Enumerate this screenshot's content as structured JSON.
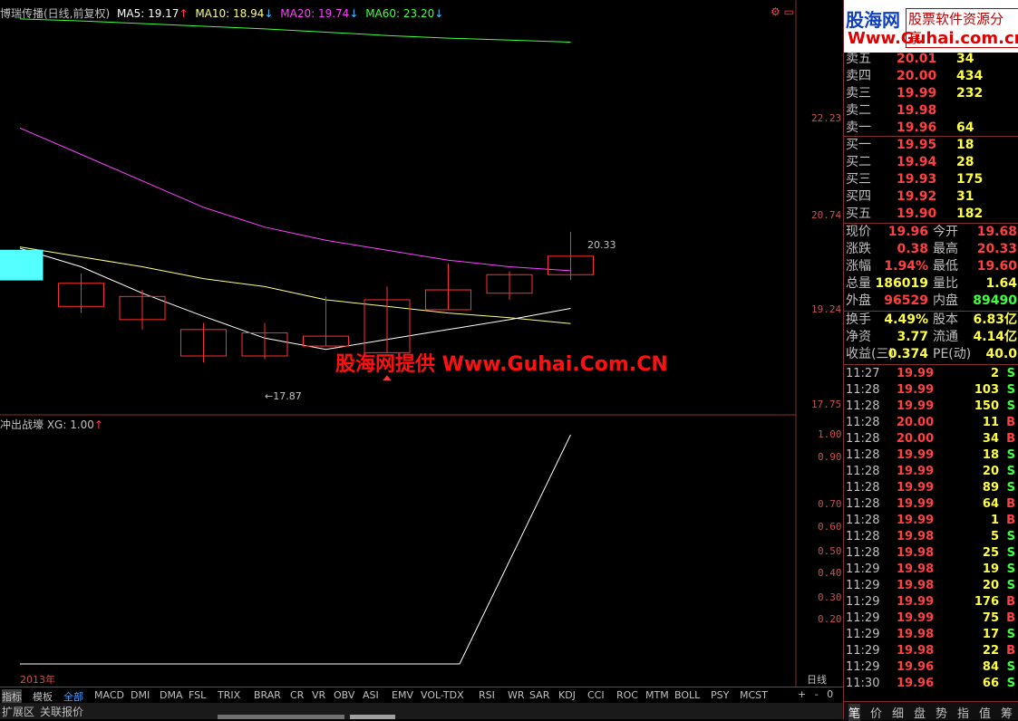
{
  "header": {
    "title": "博瑞传播(日线,前复权)",
    "ma5": "MA5: 19.17",
    "ma10": "MA10: 18.94",
    "ma20": "MA20: 19.74",
    "ma60": "MA60: 23.20",
    "colors": {
      "ma5": "#ffffff",
      "ma10": "#ffff80",
      "ma20": "#ff40ff",
      "ma60": "#40ff40"
    }
  },
  "price_axis": [
    "22.23",
    "20.74",
    "19.24",
    "17.75"
  ],
  "annotations": {
    "high_label": "20.33",
    "low_label": "←17.87"
  },
  "watermark": "股海网提供 Www.Guhai.Com.CN",
  "indicator": {
    "title": "冲出战壕 XG: 1.00",
    "axis": [
      "1.00",
      "0.90",
      "0.70",
      "0.60",
      "0.50",
      "0.40",
      "0.30",
      "0.20"
    ]
  },
  "chart_data": {
    "type": "line",
    "title": "博瑞传播(日线,前复权)",
    "candles": [
      {
        "open": 20.05,
        "close": 19.6,
        "high": 20.05,
        "low": 19.6
      },
      {
        "open": 19.2,
        "close": 19.55,
        "high": 19.7,
        "low": 19.1
      },
      {
        "open": 19.0,
        "close": 19.35,
        "high": 19.45,
        "low": 18.85
      },
      {
        "open": 18.45,
        "close": 18.85,
        "high": 18.95,
        "low": 18.35
      },
      {
        "open": 18.45,
        "close": 18.8,
        "high": 18.95,
        "low": 18.4
      },
      {
        "open": 18.6,
        "close": 18.75,
        "high": 19.35,
        "low": 18.6
      },
      {
        "open": 18.5,
        "close": 19.3,
        "high": 19.5,
        "low": 18.5
      },
      {
        "open": 19.15,
        "close": 19.45,
        "high": 19.85,
        "low": 19.15
      },
      {
        "open": 19.4,
        "close": 19.68,
        "high": 19.73,
        "low": 19.3
      },
      {
        "open": 19.68,
        "close": 19.96,
        "high": 20.33,
        "low": 19.6
      }
    ],
    "series": [
      {
        "name": "MA5",
        "values": [
          20.08,
          19.8,
          19.4,
          19.05,
          18.72,
          18.55,
          18.7,
          18.85,
          19.0,
          19.17
        ]
      },
      {
        "name": "MA10",
        "values": [
          20.1,
          19.95,
          19.8,
          19.62,
          19.5,
          19.3,
          19.2,
          19.1,
          19.03,
          18.94
        ]
      },
      {
        "name": "MA20",
        "values": [
          21.9,
          21.5,
          21.1,
          20.7,
          20.4,
          20.2,
          20.05,
          19.9,
          19.8,
          19.74
        ]
      },
      {
        "name": "MA60",
        "values": [
          23.55,
          23.52,
          23.48,
          23.44,
          23.4,
          23.35,
          23.3,
          23.26,
          23.23,
          23.2
        ]
      }
    ],
    "ylim": [
      17.6,
      23.7
    ],
    "xg_values": [
      0,
      0,
      0,
      0,
      0,
      0,
      0,
      0,
      0,
      1
    ],
    "xlabel": "2013年"
  },
  "bottom_tabs": {
    "items": [
      "指标",
      "模板",
      "全部",
      "MACD",
      "DMI",
      "DMA",
      "FSL",
      "TRIX",
      "BRAR",
      "CR",
      "VR",
      "OBV",
      "ASI",
      "EMV",
      "VOL-TDX",
      "RSI",
      "WR",
      "SAR",
      "KDJ",
      "CCI",
      "ROC",
      "MTM",
      "BOLL",
      "PSY",
      "MCST"
    ],
    "period": "日线",
    "controls": "+ - 0"
  },
  "status": {
    "left": "扩展区",
    "right": "关联报价"
  },
  "logo": {
    "title": "股海网",
    "subtitle": "股票软件资源分享",
    "url": "Www.Guhai.com.cn"
  },
  "order_book": {
    "sells": [
      {
        "label": "卖五",
        "price": "20.01",
        "vol": "34"
      },
      {
        "label": "卖四",
        "price": "20.00",
        "vol": "434"
      },
      {
        "label": "卖三",
        "price": "19.99",
        "vol": "232"
      },
      {
        "label": "卖二",
        "price": "19.98",
        "vol": ""
      },
      {
        "label": "卖一",
        "price": "19.96",
        "vol": "64"
      }
    ],
    "buys": [
      {
        "label": "买一",
        "price": "19.95",
        "vol": "18"
      },
      {
        "label": "买二",
        "price": "19.94",
        "vol": "28"
      },
      {
        "label": "买三",
        "price": "19.93",
        "vol": "175"
      },
      {
        "label": "买四",
        "price": "19.92",
        "vol": "31"
      },
      {
        "label": "买五",
        "price": "19.90",
        "vol": "182"
      }
    ]
  },
  "quote": {
    "rows": [
      {
        "l1": "现价",
        "v1": "19.96",
        "l2": "今开",
        "v2": "19.68",
        "c1": "#ff4040",
        "c2": "#ff4040"
      },
      {
        "l1": "涨跌",
        "v1": "0.38",
        "l2": "最高",
        "v2": "20.33",
        "c1": "#ff4040",
        "c2": "#ff4040"
      },
      {
        "l1": "涨幅",
        "v1": "1.94%",
        "l2": "最低",
        "v2": "19.60",
        "c1": "#ff4040",
        "c2": "#ff4040"
      },
      {
        "l1": "总量",
        "v1": "186019",
        "l2": "量比",
        "v2": "1.64",
        "c1": "#ffff40",
        "c2": "#ffff40"
      },
      {
        "l1": "外盘",
        "v1": "96529",
        "l2": "内盘",
        "v2": "89490",
        "c1": "#ff4040",
        "c2": "#40ff40"
      }
    ],
    "rows2": [
      {
        "l1": "换手",
        "v1": "4.49%",
        "l2": "股本",
        "v2": "6.83亿"
      },
      {
        "l1": "净资",
        "v1": "3.77",
        "l2": "流通",
        "v2": "4.14亿"
      },
      {
        "l1": "收益(三)",
        "v1": "0.374",
        "l2": "PE(动)",
        "v2": "40.0"
      }
    ]
  },
  "ticks": [
    {
      "time": "11:27",
      "price": "19.99",
      "vol": "2",
      "side": "S"
    },
    {
      "time": "11:28",
      "price": "19.99",
      "vol": "103",
      "side": "S"
    },
    {
      "time": "11:28",
      "price": "19.99",
      "vol": "150",
      "side": "S"
    },
    {
      "time": "11:28",
      "price": "20.00",
      "vol": "11",
      "side": "B"
    },
    {
      "time": "11:28",
      "price": "20.00",
      "vol": "34",
      "side": "B"
    },
    {
      "time": "11:28",
      "price": "19.99",
      "vol": "18",
      "side": "S"
    },
    {
      "time": "11:28",
      "price": "19.99",
      "vol": "20",
      "side": "S"
    },
    {
      "time": "11:28",
      "price": "19.99",
      "vol": "89",
      "side": "S"
    },
    {
      "time": "11:28",
      "price": "19.99",
      "vol": "64",
      "side": "B"
    },
    {
      "time": "11:28",
      "price": "19.99",
      "vol": "1",
      "side": "B"
    },
    {
      "time": "11:28",
      "price": "19.98",
      "vol": "5",
      "side": "S"
    },
    {
      "time": "11:28",
      "price": "19.98",
      "vol": "25",
      "side": "S"
    },
    {
      "time": "11:29",
      "price": "19.98",
      "vol": "19",
      "side": "S"
    },
    {
      "time": "11:29",
      "price": "19.98",
      "vol": "20",
      "side": "S"
    },
    {
      "time": "11:29",
      "price": "19.99",
      "vol": "176",
      "side": "B"
    },
    {
      "time": "11:29",
      "price": "19.99",
      "vol": "75",
      "side": "B"
    },
    {
      "time": "11:29",
      "price": "19.98",
      "vol": "17",
      "side": "S"
    },
    {
      "time": "11:29",
      "price": "19.98",
      "vol": "22",
      "side": "B"
    },
    {
      "time": "11:29",
      "price": "19.96",
      "vol": "84",
      "side": "S"
    },
    {
      "time": "11:30",
      "price": "19.96",
      "vol": "66",
      "side": "S"
    }
  ],
  "right_tabs": [
    "笔",
    "价",
    "细",
    "盘",
    "势",
    "指",
    "值",
    "筹"
  ]
}
